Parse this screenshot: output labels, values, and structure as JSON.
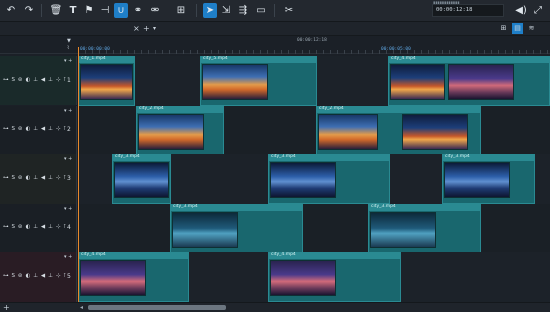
{
  "toolbar": {
    "timecode": "00:00:12:18",
    "timecode_top": "▮▮▮▮▮▮▮▮▮▮▮▮"
  },
  "strip2": {
    "close": "×",
    "add": "+",
    "dropdown": "▾"
  },
  "ruler": {
    "center_time": "00:00:12:18",
    "left_time": "00:00:00:00",
    "right_time": "00:00:05:00",
    "marker_top": "▼",
    "marker_bottom": "⌇"
  },
  "track_controls": "⊶ S ⊚ ◐ ⊥ ◀ ⊥ ⊹ ⊺",
  "tracks": [
    {
      "number": "1",
      "arrow": "▾ +"
    },
    {
      "number": "2",
      "arrow": "▾ +"
    },
    {
      "number": "3",
      "arrow": "▾ +"
    },
    {
      "number": "4",
      "arrow": "▾ +"
    },
    {
      "number": "5",
      "arrow": "▾ +"
    }
  ],
  "clips": [
    {
      "track": 0,
      "name": "city_1.mp4"
    },
    {
      "track": 0,
      "name": "city_5.mp4"
    },
    {
      "track": 0,
      "name": "city_4.mp4"
    },
    {
      "track": 1,
      "name": "city_2.mp4"
    },
    {
      "track": 1,
      "name": "city_2.mp4"
    },
    {
      "track": 2,
      "name": "city_3.mp4"
    },
    {
      "track": 2,
      "name": "city_3.mp4"
    },
    {
      "track": 2,
      "name": "city_3.mp4"
    },
    {
      "track": 3,
      "name": "city_3.mp4"
    },
    {
      "track": 3,
      "name": "city_3.mp4"
    },
    {
      "track": 4,
      "name": "city_4.mp4"
    },
    {
      "track": 4,
      "name": "city_4.mp4"
    }
  ],
  "scrollbar": {
    "add": "+",
    "left": "◂"
  },
  "colors": {
    "accent": "#1f7fc8",
    "playhead": "#e8892b",
    "clip_header": "#2a8a92",
    "clip_body": "#19676e",
    "background": "#1b2027"
  }
}
